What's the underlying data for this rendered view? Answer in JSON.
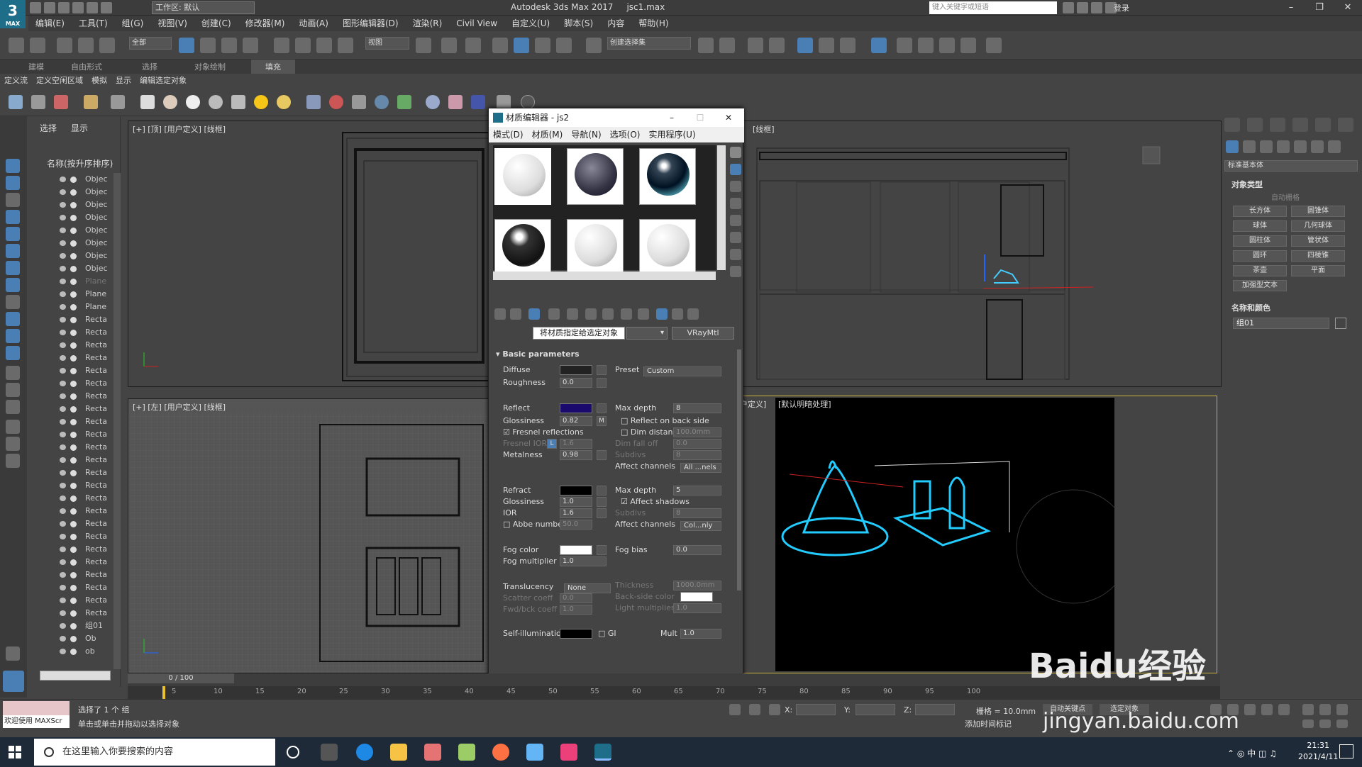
{
  "titlebar": {
    "app_logo": "3",
    "app_logo_sub": "MAX",
    "workspace": "工作区: 默认",
    "app_title": "Autodesk 3ds Max 2017",
    "file_name": "jsc1.max",
    "search_placeholder": "键入关键字或短语",
    "login": "登录"
  },
  "menubar": [
    "编辑(E)",
    "工具(T)",
    "组(G)",
    "视图(V)",
    "创建(C)",
    "修改器(M)",
    "动画(A)",
    "图形编辑器(D)",
    "渲染(R)",
    "Civil View",
    "自定义(U)",
    "脚本(S)",
    "内容",
    "帮助(H)"
  ],
  "toolbar": {
    "selection_filter": "全部",
    "ref_coord": "视图",
    "named_selection": "创建选择集"
  },
  "ribbon": {
    "tabs": [
      "建模",
      "自由形式",
      "选择",
      "对象绘制",
      "填充"
    ],
    "subtabs": [
      "定义流",
      "定义空闲区域",
      "模拟",
      "显示",
      "编辑选定对象"
    ]
  },
  "scene_explorer": {
    "tabs": [
      "选择",
      "显示"
    ],
    "column_header": "名称(按升序排序)",
    "items": [
      "Objec",
      "Objec",
      "Objec",
      "Objec",
      "Objec",
      "Objec",
      "Objec",
      "Objec",
      "Plane",
      "Plane",
      "Plane",
      "Recta",
      "Recta",
      "Recta",
      "Recta",
      "Recta",
      "Recta",
      "Recta",
      "Recta",
      "Recta",
      "Recta",
      "Recta",
      "Recta",
      "Recta",
      "Recta",
      "Recta",
      "Recta",
      "Recta",
      "Recta",
      "Recta",
      "Recta",
      "Recta",
      "Recta",
      "Recta",
      "Recta",
      "组01",
      "Ob",
      "ob"
    ]
  },
  "viewports": {
    "top_left": "[+] [顶] [用户定义] [线框]",
    "top_right": "[线框]",
    "bottom_left": "[+] [左] [用户定义] [线框]",
    "bottom_right_a": "户定义]",
    "bottom_right_b": "[默认明暗处理]"
  },
  "material_editor": {
    "title": "材质编辑器 - js2",
    "menu": [
      "模式(D)",
      "材质(M)",
      "导航(N)",
      "选项(O)",
      "实用程序(U)"
    ],
    "tooltip": "将材质指定给选定对象",
    "material_type": "VRayMtl",
    "rollout_title": "Basic parameters",
    "diffuse_label": "Diffuse",
    "preset_label": "Preset",
    "preset_value": "Custom",
    "roughness_label": "Roughness",
    "roughness_value": "0.0",
    "reflect_label": "Reflect",
    "reflect_color": "#1b0a6e",
    "max_depth_label": "Max depth",
    "max_depth_value": "8",
    "glossiness_label": "Glossiness",
    "glossiness_value": "0.82",
    "m_label": "M",
    "reflect_back_label": "Reflect on back side",
    "fresnel_label": "Fresnel reflections",
    "dim_distance_label": "Dim distance",
    "dim_distance_value": "100.0mm",
    "fresnel_ior_label": "Fresnel IOR",
    "fresnel_ior_value": "1.6",
    "l_label": "L",
    "dim_falloff_label": "Dim fall off",
    "dim_falloff_value": "0.0",
    "metalness_label": "Metalness",
    "metalness_value": "0.98",
    "subdivs_label": "Subdivs",
    "subdivs_value": "8",
    "affect_channels_label": "Affect channels",
    "affect_channels_value": "All ...nels",
    "refract_label": "Refract",
    "refract_max_depth_value": "5",
    "refract_glossiness_value": "1.0",
    "affect_shadows_label": "Affect shadows",
    "ior_label": "IOR",
    "ior_value": "1.6",
    "refract_subdivs_value": "8",
    "abbe_label": "Abbe number",
    "abbe_value": "50.0",
    "refract_affect_value": "Col...nly",
    "fog_color_label": "Fog color",
    "fog_bias_label": "Fog bias",
    "fog_bias_value": "0.0",
    "fog_mult_label": "Fog multiplier",
    "fog_mult_value": "1.0",
    "translucency_label": "Translucency",
    "translucency_value": "None",
    "thickness_label": "Thickness",
    "thickness_value": "1000.0mm",
    "scatter_label": "Scatter coeff",
    "scatter_value": "0.0",
    "backside_label": "Back-side color",
    "fwd_label": "Fwd/bck coeff",
    "fwd_value": "1.0",
    "light_mult_label": "Light multiplier",
    "light_mult_value": "1.0",
    "selfillum_label": "Self-illumination",
    "gi_label": "GI",
    "mult_label": "Mult",
    "mult_value": "1.0"
  },
  "command_panel": {
    "category": "标准基本体",
    "object_type_header": "对象类型",
    "autogrid": "自动栅格",
    "buttons": [
      "长方体",
      "圆锥体",
      "球体",
      "几何球体",
      "圆柱体",
      "管状体",
      "圆环",
      "四棱锥",
      "茶壶",
      "平面",
      "加强型文本"
    ],
    "name_color_header": "名称和颜色",
    "name_value": "组01"
  },
  "timeline": {
    "frame": "0 / 100",
    "ticks": [
      "5",
      "10",
      "15",
      "20",
      "25",
      "30",
      "35",
      "40",
      "45",
      "50",
      "55",
      "60",
      "65",
      "70",
      "75",
      "80",
      "85",
      "90",
      "95",
      "100"
    ]
  },
  "status": {
    "welcome": "欢迎使用 MAXScr",
    "selected": "选择了 1 个 组",
    "hint": "单击或单击并拖动以选择对象",
    "x_label": "X:",
    "y_label": "Y:",
    "z_label": "Z:",
    "grid": "栅格 = 10.0mm",
    "add_time_tag": "添加时间标记",
    "auto_key": "自动关键点",
    "set_key": "选定对象"
  },
  "taskbar": {
    "search_placeholder": "在这里输入你要搜索的内容",
    "time": "21:31",
    "date": "2021/4/11",
    "ime": "中"
  },
  "watermark": {
    "brand": "Baidu经验",
    "url": "jingyan.baidu.com"
  }
}
